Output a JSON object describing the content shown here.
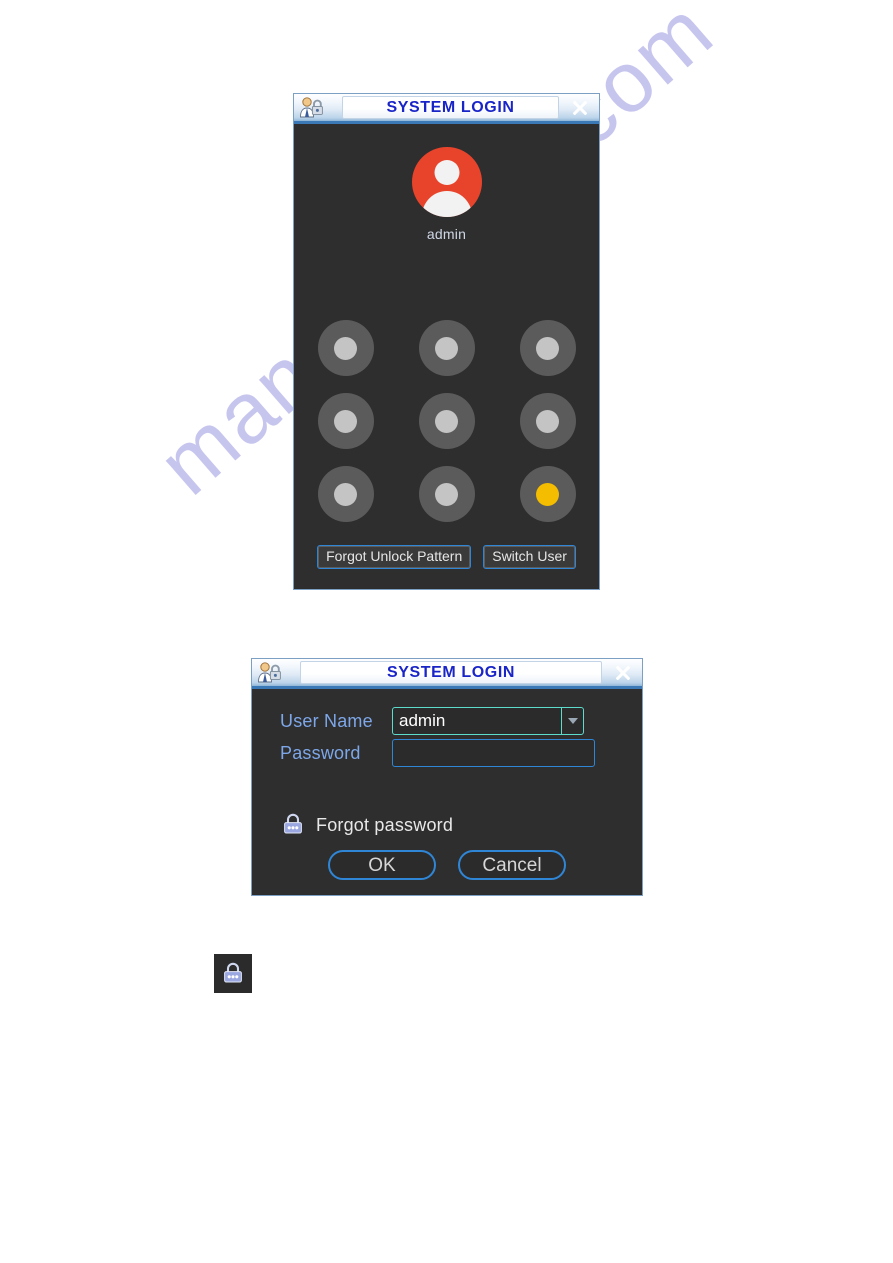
{
  "watermark": {
    "text": "manualshive.com"
  },
  "pattern_dialog": {
    "title": "SYSTEM LOGIN",
    "title_icon": "user-lock-icon",
    "close_icon": "close-icon",
    "avatar_icon": "user-avatar-icon",
    "user_name": "admin",
    "pattern_nodes": [
      {
        "id": "node-1",
        "selected": false
      },
      {
        "id": "node-2",
        "selected": false
      },
      {
        "id": "node-3",
        "selected": false
      },
      {
        "id": "node-4",
        "selected": false
      },
      {
        "id": "node-5",
        "selected": false
      },
      {
        "id": "node-6",
        "selected": false
      },
      {
        "id": "node-7",
        "selected": false
      },
      {
        "id": "node-8",
        "selected": false
      },
      {
        "id": "node-9",
        "selected": true
      }
    ],
    "forgot_pattern_label": "Forgot Unlock Pattern",
    "switch_user_label": "Switch User",
    "colors": {
      "dialog_bg": "#2e2e2e",
      "node_ring": "#5b5b5b",
      "node_dot": "#c4c4c4",
      "node_dot_active": "#f4bd00",
      "avatar_red": "#e8442c",
      "title_text": "#1a25c8",
      "button_border": "#2f86d6"
    }
  },
  "credentials_dialog": {
    "title": "SYSTEM LOGIN",
    "title_icon": "user-lock-icon",
    "close_icon": "close-icon",
    "username_label": "User Name",
    "username_value": "admin",
    "username_placeholder": "",
    "dropdown_icon": "chevron-down-icon",
    "keyboard_icon": "virtual-keyboard-icon",
    "password_label": "Password",
    "password_value": "",
    "password_placeholder": "",
    "forgot_password_icon": "lock-icon",
    "forgot_password_label": "Forgot password",
    "ok_label": "OK",
    "cancel_label": "Cancel",
    "colors": {
      "label_blue": "#7da7e8",
      "username_border": "#5ddccb",
      "password_border": "#2f86d6",
      "button_border": "#2f86d6",
      "text_white": "#e8e8e8"
    }
  },
  "lock_tile": {
    "icon": "lock-icon",
    "bg": "#2b2b2b"
  }
}
